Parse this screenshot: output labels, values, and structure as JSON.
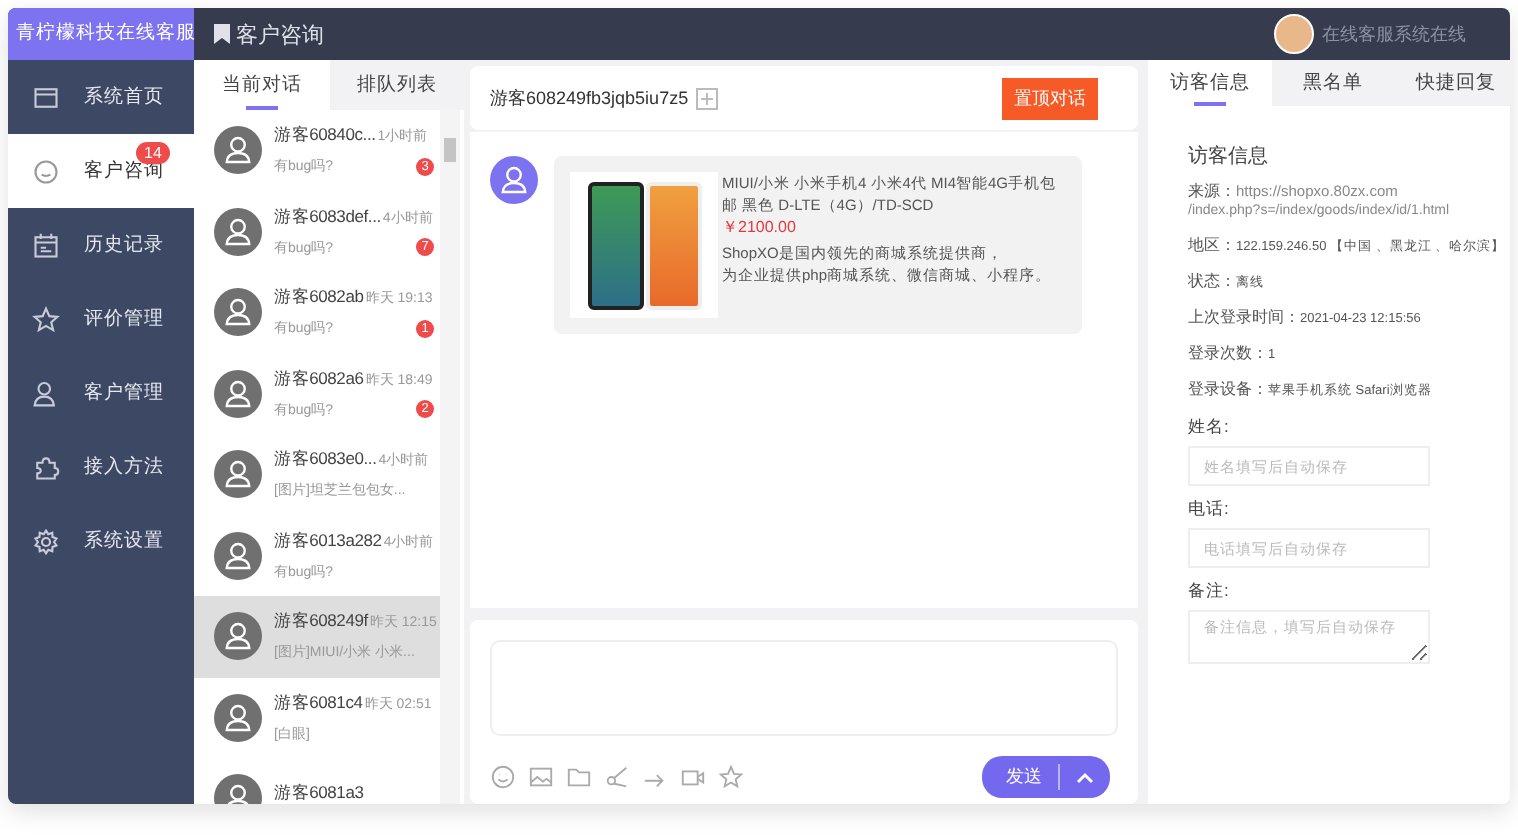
{
  "app": {
    "logo": "青柠檬科技在线客服",
    "page_title": "客户咨询",
    "agent_status": "在线客服系统在线"
  },
  "sidebar": {
    "items": [
      {
        "label": "系统首页",
        "selected": false
      },
      {
        "label": "客户咨询",
        "selected": true,
        "badge": "14"
      },
      {
        "label": "历史记录",
        "selected": false
      },
      {
        "label": "评价管理",
        "selected": false
      },
      {
        "label": "客户管理",
        "selected": false
      },
      {
        "label": "接入方法",
        "selected": false
      },
      {
        "label": "系统设置",
        "selected": false
      }
    ]
  },
  "conversation_tabs": [
    {
      "label": "当前对话",
      "selected": true
    },
    {
      "label": "排队列表",
      "selected": false
    }
  ],
  "conversations": [
    {
      "name": "游客60840c...",
      "time": "1小时前",
      "message": "有bug吗?",
      "badge": "3",
      "selected": false
    },
    {
      "name": "游客6083def...",
      "time": "4小时前",
      "message": "有bug吗?",
      "badge": "7",
      "selected": false
    },
    {
      "name": "游客6082ab",
      "time": "昨天 19:13",
      "message": "有bug吗?",
      "badge": "1",
      "selected": false
    },
    {
      "name": "游客6082a6",
      "time": "昨天 18:49",
      "message": "有bug吗?",
      "badge": "2",
      "selected": false
    },
    {
      "name": "游客6083e0...",
      "time": "4小时前",
      "message": "[图片]坦芝兰包包女...",
      "selected": false
    },
    {
      "name": "游客6013a282",
      "time": "4小时前",
      "message": "有bug吗?",
      "selected": false
    },
    {
      "name": "游客608249f",
      "time": "昨天 12:15",
      "message": "[图片]MIUI/小米 小米...",
      "selected": true
    },
    {
      "name": "游客6081c4",
      "time": "昨天 02:51",
      "message": "[白眼]",
      "selected": false
    },
    {
      "name": "游客6081a3",
      "selected": false
    }
  ],
  "chat": {
    "visitor": "游客608249fb3jqb5iu7z5",
    "pin_button": "置顶对话",
    "messages": [
      {
        "kind": "product",
        "title": "MIUI/小米 小米手机4 小米4代 MI4智能4G手机包邮 黑色 D-LTE（4G）/TD-SCD",
        "price": "￥2100.00",
        "description_lines": [
          "ShopXO是国内领先的商城系统提供商，",
          "为企业提供php商城系统、微信商城、小程序。"
        ]
      }
    ],
    "send_button": "发送"
  },
  "info_tabs": [
    {
      "label": "访客信息",
      "selected": true
    },
    {
      "label": "黑名单",
      "selected": false
    },
    {
      "label": "快捷回复",
      "selected": false
    }
  ],
  "visitor_info": {
    "heading": "访客信息",
    "rows": [
      {
        "label": "来源：",
        "value": "https://shopxo.80zx.com",
        "value_continued": "/index.php?s=/index/goods/index/id/1.html"
      },
      {
        "label": "地区：",
        "value": "122.159.246.50 【中国 、黑龙江 、哈尔滨】"
      },
      {
        "label": "状态：",
        "value": "离线"
      },
      {
        "label": "上次登录时间：",
        "value": "2021-04-23 12:15:56"
      },
      {
        "label": "登录次数：",
        "value": "1"
      },
      {
        "label": "登录设备：",
        "value": "苹果手机系统 Safari浏览器"
      }
    ],
    "fields": [
      {
        "label": "姓名:",
        "placeholder": "姓名填写后自动保存",
        "kind": "input"
      },
      {
        "label": "电话:",
        "placeholder": "电话填写后自动保存",
        "kind": "input"
      },
      {
        "label": "备注:",
        "placeholder": "备注信息，填写后自动保存",
        "kind": "textarea"
      }
    ]
  }
}
